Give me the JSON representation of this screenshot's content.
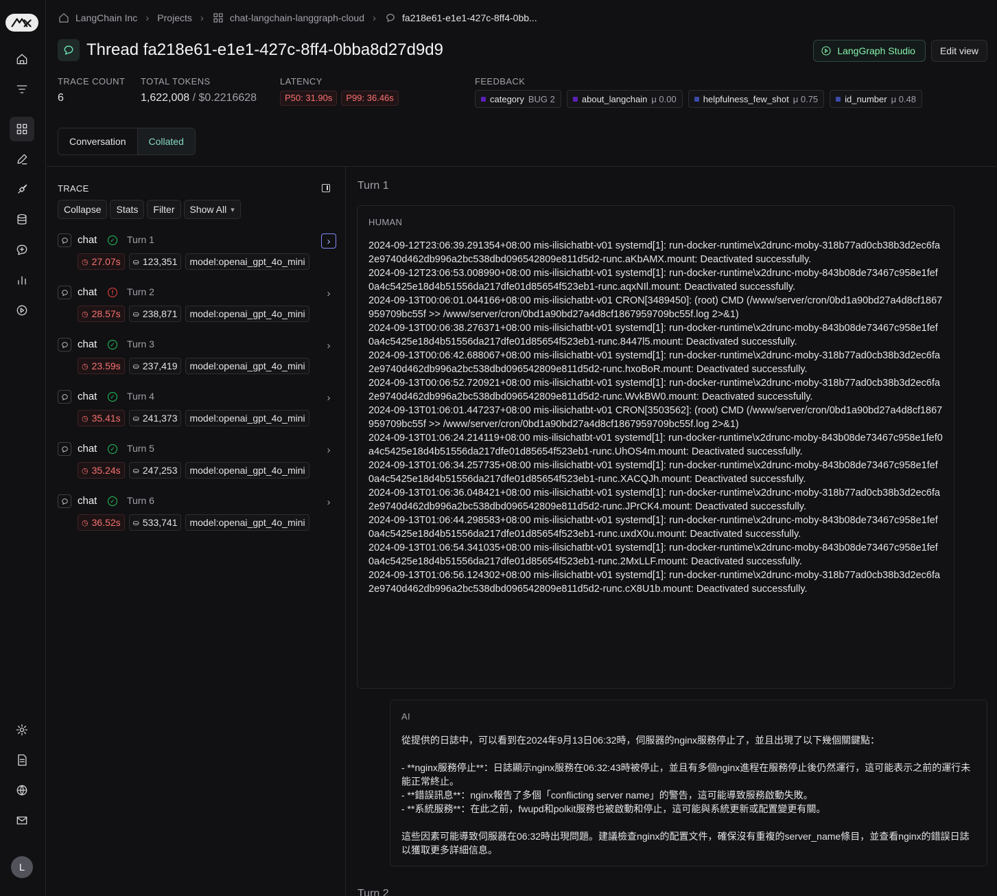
{
  "breadcrumbs": {
    "org": "LangChain Inc",
    "projects": "Projects",
    "project": "chat-langchain-langgraph-cloud",
    "thread": "fa218e61-e1e1-427c-8ff4-0bb..."
  },
  "header": {
    "title": "Thread fa218e61-e1e1-427c-8ff4-0bba8d27d9d9",
    "studio_label": "LangGraph Studio",
    "edit_label": "Edit view"
  },
  "stats": {
    "trace_count_label": "TRACE COUNT",
    "trace_count": "6",
    "tokens_label": "TOTAL TOKENS",
    "tokens": "1,622,008",
    "tokens_sep": " / ",
    "cost": "$0.2216628",
    "latency_label": "LATENCY",
    "p50": "P50: 31.90s",
    "p99": "P99: 36.46s",
    "feedback_label": "FEEDBACK",
    "feedback": [
      {
        "key": "category",
        "value": "BUG 2",
        "color": "#5b21b6"
      },
      {
        "key": "about_langchain",
        "value": "μ 0.00",
        "color": "#5b21b6"
      },
      {
        "key": "helpfulness_few_shot",
        "value": "μ 0.75",
        "color": "#3b4ba8"
      },
      {
        "key": "id_number",
        "value": "μ 0.48",
        "color": "#3b4ba8"
      }
    ]
  },
  "tabs": {
    "conversation": "Conversation",
    "collated": "Collated",
    "active": "Collated"
  },
  "trace": {
    "heading": "TRACE",
    "collapse": "Collapse",
    "stats": "Stats",
    "filter": "Filter",
    "show_all": "Show All",
    "runs": [
      {
        "name": "chat",
        "turn": "Turn 1",
        "status": "success",
        "latency": "27.07s",
        "tokens": "123,351",
        "model": "model:openai_gpt_4o_mini"
      },
      {
        "name": "chat",
        "turn": "Turn 2",
        "status": "error",
        "latency": "28.57s",
        "tokens": "238,871",
        "model": "model:openai_gpt_4o_mini"
      },
      {
        "name": "chat",
        "turn": "Turn 3",
        "status": "success",
        "latency": "23.59s",
        "tokens": "237,419",
        "model": "model:openai_gpt_4o_mini"
      },
      {
        "name": "chat",
        "turn": "Turn 4",
        "status": "success",
        "latency": "35.41s",
        "tokens": "241,373",
        "model": "model:openai_gpt_4o_mini"
      },
      {
        "name": "chat",
        "turn": "Turn 5",
        "status": "success",
        "latency": "35.24s",
        "tokens": "247,253",
        "model": "model:openai_gpt_4o_mini"
      },
      {
        "name": "chat",
        "turn": "Turn 6",
        "status": "success",
        "latency": "36.52s",
        "tokens": "533,741",
        "model": "model:openai_gpt_4o_mini"
      }
    ]
  },
  "conversation": {
    "turn1_label": "Turn 1",
    "turn2_label": "Turn 2",
    "human_role": "HUMAN",
    "human_text": "2024-09-12T23:06:39.291354+08:00 mis-ilisichatbt-v01 systemd[1]: run-docker-runtime\\x2drunc-moby-318b77ad0cb38b3d2ec6fa2e9740d462db996a2bc538dbd096542809e811d5d2-runc.aKbAMX.mount: Deactivated successfully.\n2024-09-12T23:06:53.008990+08:00 mis-ilisichatbt-v01 systemd[1]: run-docker-runtime\\x2drunc-moby-843b08de73467c958e1fef0a4c5425e18d4b51556da217dfe01d85654f523eb1-runc.aqxNIl.mount: Deactivated successfully.\n2024-09-13T00:06:01.044166+08:00 mis-ilisichatbt-v01 CRON[3489450]: (root) CMD (/www/server/cron/0bd1a90bd27a4d8cf1867959709bc55f >> /www/server/cron/0bd1a90bd27a4d8cf1867959709bc55f.log 2>&1)\n2024-09-13T00:06:38.276371+08:00 mis-ilisichatbt-v01 systemd[1]: run-docker-runtime\\x2drunc-moby-843b08de73467c958e1fef0a4c5425e18d4b51556da217dfe01d85654f523eb1-runc.8447l5.mount: Deactivated successfully.\n2024-09-13T00:06:42.688067+08:00 mis-ilisichatbt-v01 systemd[1]: run-docker-runtime\\x2drunc-moby-318b77ad0cb38b3d2ec6fa2e9740d462db996a2bc538dbd096542809e811d5d2-runc.hxoBoR.mount: Deactivated successfully.\n2024-09-13T00:06:52.720921+08:00 mis-ilisichatbt-v01 systemd[1]: run-docker-runtime\\x2drunc-moby-318b77ad0cb38b3d2ec6fa2e9740d462db996a2bc538dbd096542809e811d5d2-runc.WvkBW0.mount: Deactivated successfully.\n2024-09-13T01:06:01.447237+08:00 mis-ilisichatbt-v01 CRON[3503562]: (root) CMD (/www/server/cron/0bd1a90bd27a4d8cf1867959709bc55f >> /www/server/cron/0bd1a90bd27a4d8cf1867959709bc55f.log 2>&1)\n2024-09-13T01:06:24.214119+08:00 mis-ilisichatbt-v01 systemd[1]: run-docker-runtime\\x2drunc-moby-843b08de73467c958e1fef0a4c5425e18d4b51556da217dfe01d85654f523eb1-runc.UhOS4m.mount: Deactivated successfully.\n2024-09-13T01:06:34.257735+08:00 mis-ilisichatbt-v01 systemd[1]: run-docker-runtime\\x2drunc-moby-843b08de73467c958e1fef0a4c5425e18d4b51556da217dfe01d85654f523eb1-runc.XACQJh.mount: Deactivated successfully.\n2024-09-13T01:06:36.048421+08:00 mis-ilisichatbt-v01 systemd[1]: run-docker-runtime\\x2drunc-moby-318b77ad0cb38b3d2ec6fa2e9740d462db996a2bc538dbd096542809e811d5d2-runc.JPrCK4.mount: Deactivated successfully.\n2024-09-13T01:06:44.298583+08:00 mis-ilisichatbt-v01 systemd[1]: run-docker-runtime\\x2drunc-moby-843b08de73467c958e1fef0a4c5425e18d4b51556da217dfe01d85654f523eb1-runc.uxdX0u.mount: Deactivated successfully.\n2024-09-13T01:06:54.341035+08:00 mis-ilisichatbt-v01 systemd[1]: run-docker-runtime\\x2drunc-moby-843b08de73467c958e1fef0a4c5425e18d4b51556da217dfe01d85654f523eb1-runc.2MxLLF.mount: Deactivated successfully.\n2024-09-13T01:06:56.124302+08:00 mis-ilisichatbt-v01 systemd[1]: run-docker-runtime\\x2drunc-moby-318b77ad0cb38b3d2ec6fa2e9740d462db996a2bc538dbd096542809e811d5d2-runc.cX8U1b.mount: Deactivated successfully.",
    "ai_role": "AI",
    "ai_text": "從提供的日誌中，可以看到在2024年9月13日06:32時，伺服器的nginx服務停止了，並且出現了以下幾個關鍵點：\n\n- **nginx服務停止**：日誌顯示nginx服務在06:32:43時被停止，並且有多個nginx進程在服務停止後仍然運行，這可能表示之前的運行未能正常終止。\n- **錯誤訊息**：nginx報告了多個「conflicting server name」的警告，這可能導致服務啟動失敗。\n- **系統服務**：在此之前，fwupd和polkit服務也被啟動和停止，這可能與系統更新或配置變更有關。\n\n這些因素可能導致伺服器在06:32時出現問題。建議檢查nginx的配置文件，確保沒有重複的server_name條目，並查看nginx的錯誤日誌以獲取更多詳細信息。"
  },
  "user": {
    "initial": "L"
  }
}
